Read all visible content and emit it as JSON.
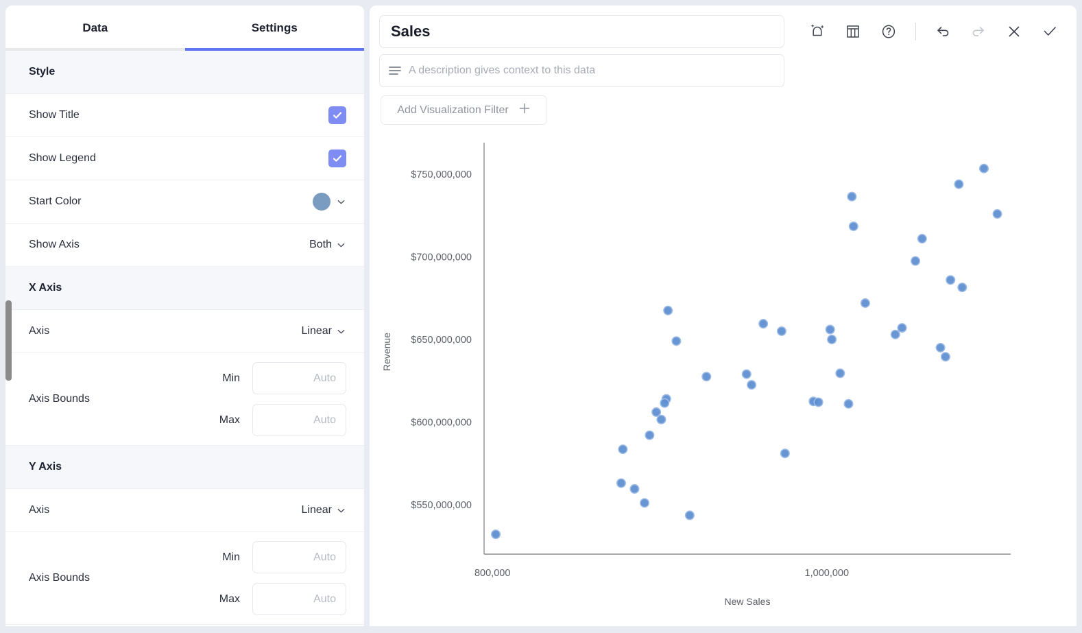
{
  "sidebar": {
    "tabs": [
      {
        "label": "Data",
        "active": false
      },
      {
        "label": "Settings",
        "active": true
      }
    ],
    "sections": [
      {
        "header": "Style",
        "rows": [
          {
            "label": "Show Title",
            "control": "checkbox",
            "value": "checked"
          },
          {
            "label": "Show Legend",
            "control": "checkbox",
            "value": "checked"
          },
          {
            "label": "Start Color",
            "control": "color",
            "value": "#7a9cc0"
          },
          {
            "label": "Show Axis",
            "control": "select",
            "value": "Both"
          }
        ]
      },
      {
        "header": "X Axis",
        "rows": [
          {
            "label": "Axis",
            "control": "select",
            "value": "Linear"
          },
          {
            "label": "Axis Bounds",
            "control": "bounds",
            "min_label": "Min",
            "min_value": "",
            "min_placeholder": "Auto",
            "max_label": "Max",
            "max_value": "",
            "max_placeholder": "Auto"
          }
        ]
      },
      {
        "header": "Y Axis",
        "rows": [
          {
            "label": "Axis",
            "control": "select",
            "value": "Linear"
          },
          {
            "label": "Axis Bounds",
            "control": "bounds",
            "min_label": "Min",
            "min_value": "",
            "min_placeholder": "Auto",
            "max_label": "Max",
            "max_value": "",
            "max_placeholder": "Auto"
          }
        ]
      }
    ]
  },
  "main": {
    "title_value": "Sales",
    "title_placeholder": "Title",
    "description_value": "",
    "description_placeholder": "A description gives context to this data",
    "filter_button_label": "Add Visualization Filter",
    "toolbar": [
      {
        "name": "ai-magic-icon",
        "tooltip": "AI Assist"
      },
      {
        "name": "table-icon",
        "tooltip": "Show data table"
      },
      {
        "name": "help-icon",
        "tooltip": "Help"
      },
      {
        "name": "divider",
        "tooltip": ""
      },
      {
        "name": "undo-icon",
        "tooltip": "Undo"
      },
      {
        "name": "redo-icon",
        "tooltip": "Redo"
      },
      {
        "name": "close-icon",
        "tooltip": "Discard"
      },
      {
        "name": "check-icon",
        "tooltip": "Save"
      }
    ]
  },
  "chart_data": {
    "type": "scatter",
    "title": "Sales",
    "xlabel": "New Sales",
    "ylabel": "Revenue",
    "grid": false,
    "legend": "none",
    "xlim": [
      795000,
      1110000
    ],
    "ylim": [
      520000000,
      765000000
    ],
    "xticks": [
      800000,
      1000000
    ],
    "xticklabels": [
      "800,000",
      "1,000,000"
    ],
    "yticks": [
      550000000,
      600000000,
      650000000,
      700000000,
      750000000
    ],
    "yticklabels": [
      "$550,000,000",
      "$600,000,000",
      "$650,000,000",
      "$700,000,000",
      "$750,000,000"
    ],
    "marker_color": "#5b8dd0",
    "marker_edge_color": "#9dbbe4",
    "points": [
      {
        "x": 802000,
        "y": 532000000
      },
      {
        "x": 877000,
        "y": 563000000
      },
      {
        "x": 885000,
        "y": 559500000
      },
      {
        "x": 891000,
        "y": 551000000
      },
      {
        "x": 918000,
        "y": 543500000
      },
      {
        "x": 878000,
        "y": 583500000
      },
      {
        "x": 894000,
        "y": 592000000
      },
      {
        "x": 898000,
        "y": 606000000
      },
      {
        "x": 901000,
        "y": 601500000
      },
      {
        "x": 904000,
        "y": 614000000
      },
      {
        "x": 903000,
        "y": 611500000
      },
      {
        "x": 910000,
        "y": 649000000
      },
      {
        "x": 905000,
        "y": 667500000
      },
      {
        "x": 928000,
        "y": 627500000
      },
      {
        "x": 952000,
        "y": 629000000
      },
      {
        "x": 955000,
        "y": 622500000
      },
      {
        "x": 962000,
        "y": 659500000
      },
      {
        "x": 973000,
        "y": 655000000
      },
      {
        "x": 975000,
        "y": 581000000
      },
      {
        "x": 992000,
        "y": 612500000
      },
      {
        "x": 995000,
        "y": 612000000
      },
      {
        "x": 1008000,
        "y": 629500000
      },
      {
        "x": 1013000,
        "y": 611000000
      },
      {
        "x": 1002000,
        "y": 656000000
      },
      {
        "x": 1003000,
        "y": 650000000
      },
      {
        "x": 1023000,
        "y": 672000000
      },
      {
        "x": 1016000,
        "y": 718500000
      },
      {
        "x": 1015000,
        "y": 736500000
      },
      {
        "x": 1041000,
        "y": 653000000
      },
      {
        "x": 1045000,
        "y": 657000000
      },
      {
        "x": 1053000,
        "y": 697500000
      },
      {
        "x": 1057000,
        "y": 711000000
      },
      {
        "x": 1068000,
        "y": 645000000
      },
      {
        "x": 1071000,
        "y": 639500000
      },
      {
        "x": 1074000,
        "y": 686000000
      },
      {
        "x": 1079000,
        "y": 744000000
      },
      {
        "x": 1081000,
        "y": 681500000
      },
      {
        "x": 1094000,
        "y": 753500000
      },
      {
        "x": 1102000,
        "y": 726000000
      }
    ]
  }
}
